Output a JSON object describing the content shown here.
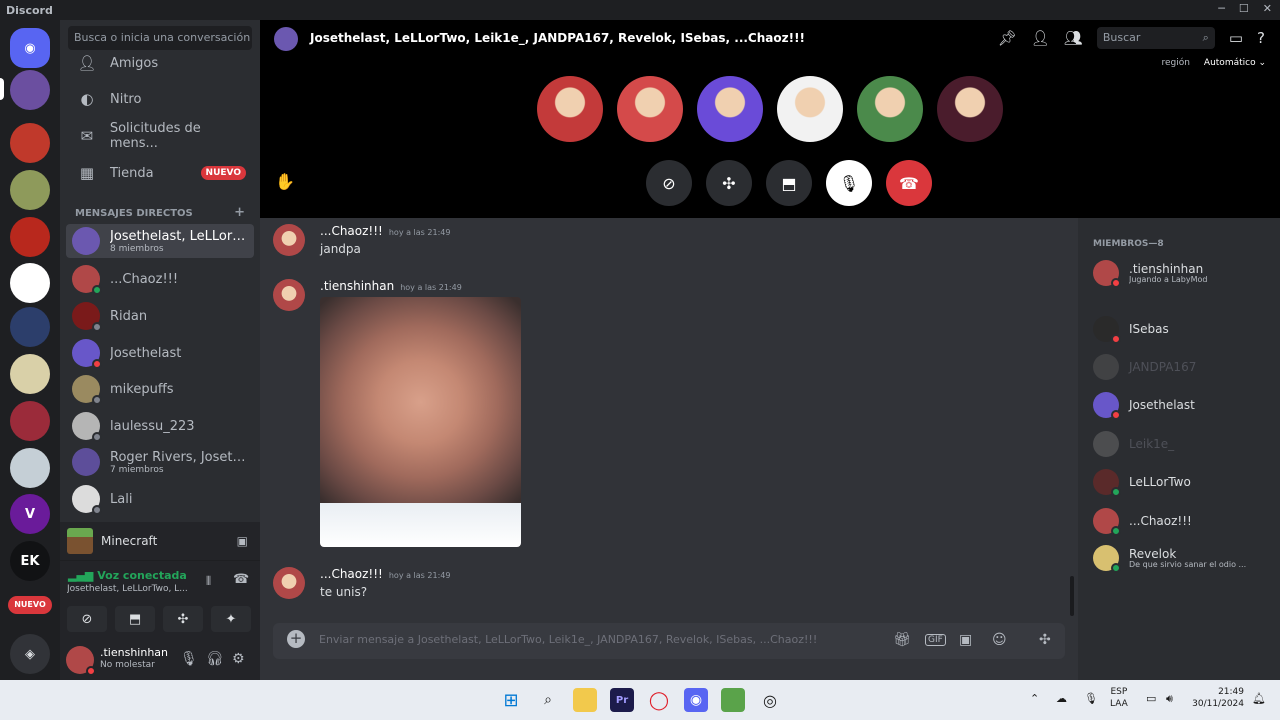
{
  "app": {
    "title": "Discord"
  },
  "servers": {
    "items": [
      {
        "name": "discord-home",
        "label": "",
        "color": "#5865f2"
      },
      {
        "name": "server-2",
        "label": "",
        "color": "#6b4fa0"
      },
      {
        "name": "server-3",
        "label": "",
        "color": "#c0392b"
      },
      {
        "name": "server-4",
        "label": "",
        "color": "#8e9a5b"
      },
      {
        "name": "server-5",
        "label": "",
        "color": "#b8281d"
      },
      {
        "name": "server-6",
        "label": "",
        "color": "#ffffff"
      },
      {
        "name": "server-7",
        "label": "",
        "color": "#2c3e6b"
      },
      {
        "name": "server-8",
        "label": "",
        "color": "#d9d0a8"
      },
      {
        "name": "server-9",
        "label": "",
        "color": "#9b2b3a"
      },
      {
        "name": "server-10",
        "label": "",
        "color": "#c5cfd6"
      },
      {
        "name": "server-11",
        "label": "V",
        "color": "#6a1b9a"
      },
      {
        "name": "server-12",
        "label": "EK",
        "color": "#111214"
      }
    ],
    "new_badge": "NUEVO"
  },
  "sidebar": {
    "search_placeholder": "Busca o inicia una conversación",
    "nav": [
      {
        "label": "Amigos",
        "icon": "friends-icon"
      },
      {
        "label": "Nitro",
        "icon": "nitro-icon"
      },
      {
        "label": "Solicitudes de mens...",
        "icon": "message-requests-icon"
      },
      {
        "label": "Tienda",
        "icon": "shop-icon",
        "badge": "NUEVO"
      }
    ],
    "dm_header": "MENSAJES DIRECTOS",
    "dm_add": "+",
    "dms": [
      {
        "name": "Josethelast, LeLLorT...",
        "sub": "8 miembros",
        "color": "#6b58b0",
        "status": ""
      },
      {
        "name": "...Chaoz!!!",
        "sub": "",
        "color": "#b04848",
        "status": "#23a55a"
      },
      {
        "name": "Ridan",
        "sub": "",
        "color": "#7a1a1a",
        "status": "#80848e"
      },
      {
        "name": "Josethelast",
        "sub": "",
        "color": "#6857c9",
        "status": "#f23f43"
      },
      {
        "name": "mikepuffs",
        "sub": "",
        "color": "#9a8a60",
        "status": "#80848e"
      },
      {
        "name": "laulessu_223",
        "sub": "",
        "color": "#b5b5b5",
        "status": "#80848e"
      },
      {
        "name": "Roger Rivers, Josethe...",
        "sub": "7 miembros",
        "color": "#5d4e9a",
        "status": ""
      },
      {
        "name": "Lali",
        "sub": "",
        "color": "#dcdcdc",
        "status": "#80848e"
      }
    ],
    "game": "Minecraft",
    "voice": {
      "status": "Voz conectada",
      "channel": "Josethelast, LeLLorTwo, L..."
    },
    "user": {
      "name": ".tienshinhan",
      "status": "No molestar"
    }
  },
  "call": {
    "title": "Josethelast, LeLLorTwo, Leik1e_, JANDPA167, Revelok, ISebas, ...Chaoz!!!",
    "search_placeholder": "Buscar",
    "region_label": "región",
    "region_value": "Automático",
    "avatars": [
      "#c33a3a",
      "#d44a4a",
      "#6a4bd8",
      "#f2f2f2",
      "#4b8a4b",
      "#4a1c2c"
    ]
  },
  "messages": [
    {
      "author": "...Chaoz!!!",
      "time": "hoy a las 21:49",
      "text": "jandpa",
      "type": "text"
    },
    {
      "author": ".tienshinhan",
      "time": "hoy a las 21:49",
      "text": "",
      "type": "image"
    },
    {
      "author": "...Chaoz!!!",
      "time": "hoy a las 21:49",
      "text": "te unis?",
      "type": "text"
    }
  ],
  "composer": {
    "placeholder": "Enviar mensaje a Josethelast, LeLLorTwo, Leik1e_, JANDPA167, Revelok, ISebas, ...Chaoz!!!",
    "gif_label": "GIF"
  },
  "members": {
    "header": "MIEMBROS—8",
    "list": [
      {
        "name": ".tienshinhan",
        "sub": "Jugando a LabyMod",
        "color": "#b04848",
        "status": "#f23f43",
        "dim": false
      },
      {
        "name": "ISebas",
        "sub": "",
        "color": "#2a2a2a",
        "status": "#f23f43",
        "dim": false
      },
      {
        "name": "JANDPA167",
        "sub": "",
        "color": "#6a6a6a",
        "status": "",
        "dim": true
      },
      {
        "name": "Josethelast",
        "sub": "",
        "color": "#6857c9",
        "status": "#f23f43",
        "dim": false
      },
      {
        "name": "Leik1e_",
        "sub": "",
        "color": "#8a8a8a",
        "status": "",
        "dim": true
      },
      {
        "name": "LeLLorTwo",
        "sub": "",
        "color": "#5a2a2a",
        "status": "#23a55a",
        "dim": false
      },
      {
        "name": "...Chaoz!!!",
        "sub": "",
        "color": "#b04848",
        "status": "#23a55a",
        "dim": false
      },
      {
        "name": "Revelok",
        "sub": "De que sirvio sanar el odio ...",
        "color": "#d8c070",
        "status": "#23a55a",
        "dim": false
      }
    ]
  },
  "taskbar": {
    "lang": "ESP",
    "lang_sub": "LAA",
    "time": "21:49",
    "date": "30/11/2024"
  }
}
